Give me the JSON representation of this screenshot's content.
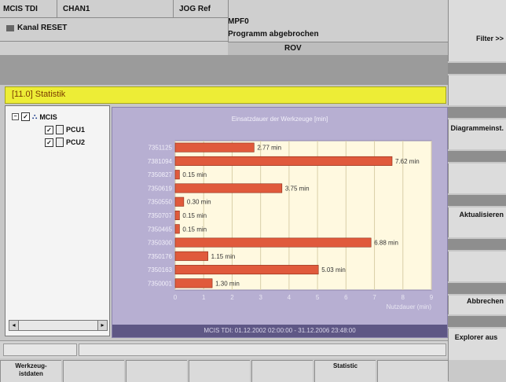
{
  "header": {
    "mode": "MCIS TDI",
    "channel": "CHAN1",
    "jog": "JOG Ref",
    "reset": "Kanal RESET",
    "program": "MPF0",
    "message": "Programm abgebrochen",
    "rov": "ROV"
  },
  "title": "[11.0] Statistik",
  "tree": {
    "root": "MCIS",
    "children": [
      "PCU1",
      "PCU2"
    ]
  },
  "right_softkeys": [
    "Filter >>",
    "Diagrammeinst.",
    "Aktualisieren",
    "Abbrechen",
    "Explorer aus"
  ],
  "bottom_softkeys": [
    "Werkzeug-\nistdaten",
    "",
    "",
    "",
    "",
    "Statistic",
    "",
    ""
  ],
  "chart_data": {
    "type": "bar",
    "title": "Einsatzdauer der Werkzeuge [min]",
    "categories": [
      "7351125",
      "7381094",
      "7350827",
      "7350619",
      "7350550",
      "7350707",
      "7350465",
      "7350300",
      "7350176",
      "7350163",
      "7350001"
    ],
    "values": [
      2.77,
      7.62,
      0.15,
      3.75,
      0.3,
      0.15,
      0.15,
      6.88,
      1.15,
      5.03,
      1.3
    ],
    "value_labels": [
      "2.77 min",
      "7.62 min",
      "0.15 min",
      "3.75 min",
      "0.30 min",
      "0.15 min",
      "0.15 min",
      "6.88 min",
      "1.15 min",
      "5.03 min",
      "1.30 min"
    ],
    "xlabel": "Nutzdauer (min)",
    "xticks": [
      0,
      1,
      2,
      3,
      4,
      5,
      6,
      7,
      8,
      9
    ],
    "xlim": [
      0,
      9
    ],
    "grid": true,
    "footer": "MCIS TDI: 01.12.2002 02:00:00 - 31.12.2006 23:48:00",
    "colors": {
      "bar": "#e05a3c",
      "plot_bg": "#fff9e0",
      "panel_bg": "#b7afd2"
    }
  }
}
